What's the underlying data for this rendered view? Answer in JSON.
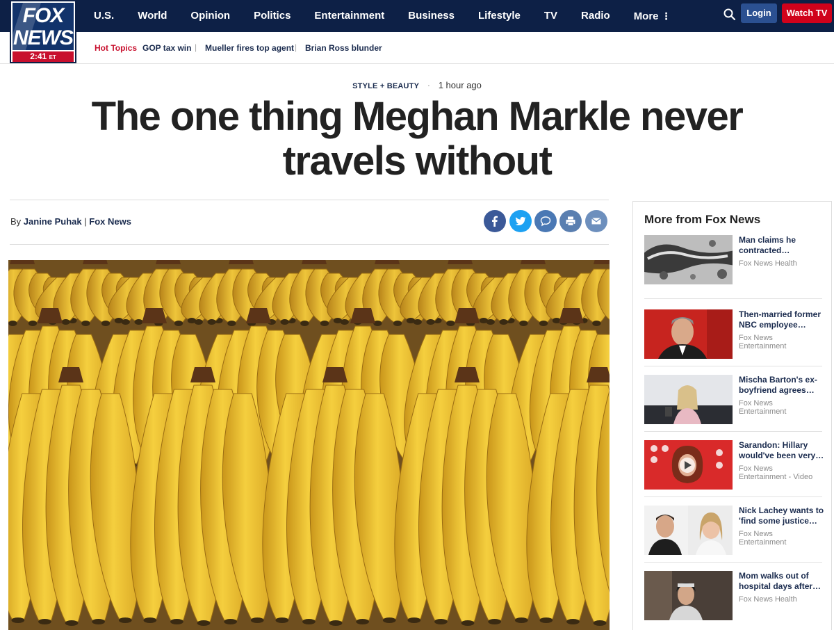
{
  "logo": {
    "line1": "FOX",
    "line2": "NEWS",
    "time": "2:41",
    "timezone": "ET"
  },
  "nav": {
    "items": [
      "U.S.",
      "World",
      "Opinion",
      "Politics",
      "Entertainment",
      "Business",
      "Lifestyle",
      "TV",
      "Radio",
      "More"
    ],
    "more_icon": "vertical-dots-icon",
    "search_icon": "search-icon",
    "login_label": "Login",
    "watch_label": "Watch TV"
  },
  "hot_topics": {
    "label": "Hot Topics",
    "items": [
      "GOP tax win",
      "Mueller fires top agent",
      "Brian Ross blunder"
    ]
  },
  "article": {
    "category": "STYLE + BEAUTY",
    "separator": "·",
    "time_ago": "1 hour ago",
    "headline": "The one thing Meghan Markle never travels without",
    "byline_prefix": "By",
    "author": "Janine Puhak",
    "byline_sep": "|",
    "outlet": "Fox News",
    "share_icons": [
      "facebook-icon",
      "twitter-icon",
      "comment-icon",
      "print-icon",
      "email-icon"
    ]
  },
  "sidebar": {
    "title": "More from Fox News",
    "items": [
      {
        "headline": "Man claims he contracted…",
        "source": "Fox News Health"
      },
      {
        "headline": "Then-married former NBC employee…",
        "source": "Fox News Entertainment"
      },
      {
        "headline": "Mischa Barton's ex-boyfriend agrees…",
        "source": "Fox News Entertainment"
      },
      {
        "headline": "Sarandon: Hillary would've been very…",
        "source": "Fox News Entertainment - Video"
      },
      {
        "headline": "Nick Lachey wants to 'find some justice…",
        "source": "Fox News Entertainment"
      },
      {
        "headline": "Mom walks out of hospital days after…",
        "source": "Fox News Health"
      }
    ]
  },
  "colors": {
    "nav_bg": "#0d2046",
    "accent_red": "#c8102e",
    "login_blue": "#2b5091",
    "link_navy": "#1a2b4e",
    "facebook": "#3b5998",
    "twitter": "#1da1f2"
  }
}
